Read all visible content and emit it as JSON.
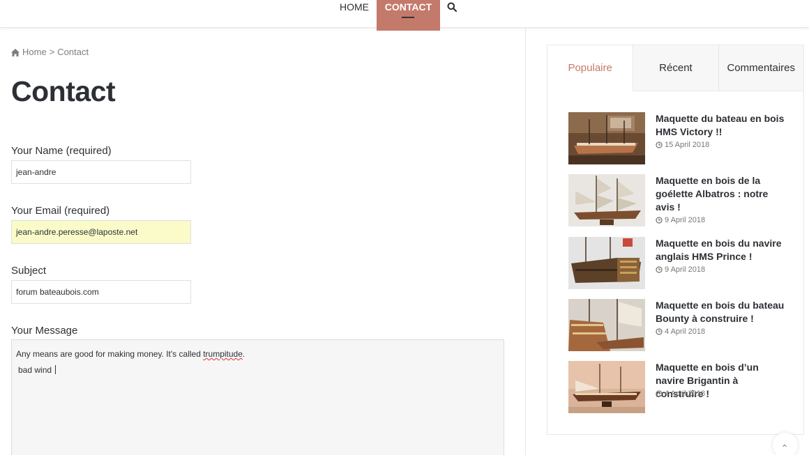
{
  "nav": {
    "items": [
      {
        "label": "HOME"
      },
      {
        "label": "CONTACT"
      }
    ],
    "icons": {
      "search": "search-icon"
    }
  },
  "breadcrumb": {
    "home": "Home",
    "separator": ">",
    "current": "Contact"
  },
  "page": {
    "title": "Contact"
  },
  "form": {
    "name_label": "Your Name (required)",
    "name_value": "jean-andre",
    "email_label": "Your Email (required)",
    "email_value": "jean-andre.peresse@laposte.net",
    "subject_label": "Subject",
    "subject_value": "forum bateaubois.com",
    "message_label": "Your Message",
    "message_line1_a": "Any means are good for making money. It's called ",
    "message_line1_misspelled": "trumpitude",
    "message_line1_b": ".",
    "message_line2": "bad wind "
  },
  "sidebar": {
    "tabs": [
      {
        "label": "Populaire"
      },
      {
        "label": "Récent"
      },
      {
        "label": "Commentaires"
      }
    ],
    "posts": [
      {
        "title": "Maquette du bateau en bois HMS Victory !!",
        "date": "15 April 2018"
      },
      {
        "title": "Maquette en bois de la goélette Albatros : notre avis !",
        "date": "9 April 2018"
      },
      {
        "title": "Maquette en bois du navire anglais HMS Prince !",
        "date": "9 April 2018"
      },
      {
        "title": "Maquette en bois du bateau Bounty à construire !",
        "date": "4 April 2018"
      },
      {
        "title": "Maquette en bois d’un navire Brigantin à construire !",
        "date": "4 April 2018"
      }
    ]
  },
  "colors": {
    "accent": "#c47a6a",
    "autofill": "#fbfbc9",
    "text": "#2c2f34"
  }
}
